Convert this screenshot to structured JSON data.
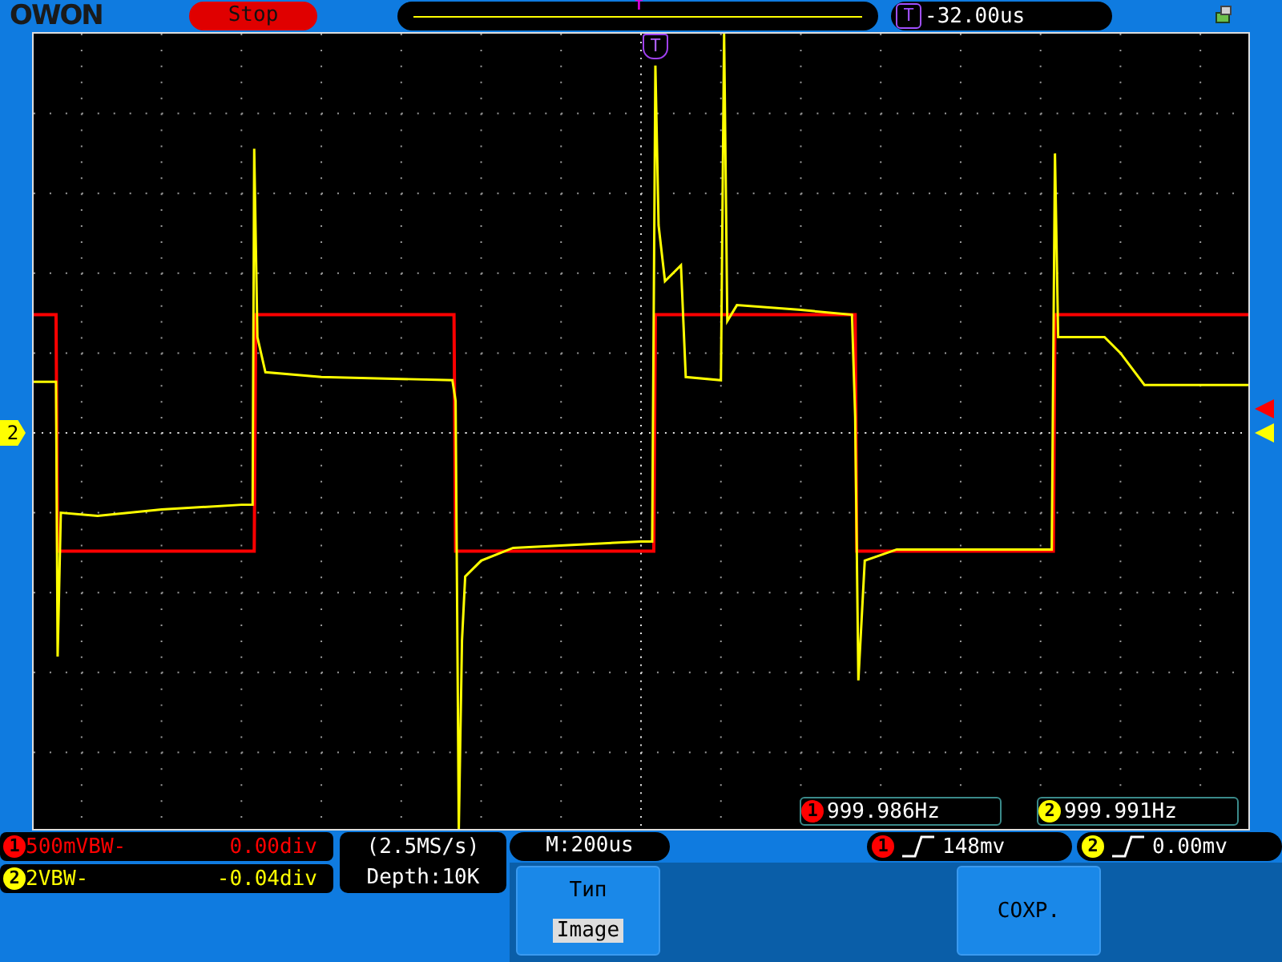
{
  "brand": {
    "logo": "OWON"
  },
  "run_state": {
    "label": "Stop"
  },
  "trigger_position": {
    "marker": "T"
  },
  "trigger_offset": {
    "badge": "T",
    "value": "-32.00us"
  },
  "screen": {
    "trigger_marker": "T",
    "ground_marker": "2",
    "frequencies": [
      {
        "channel": "1",
        "value": "999.986Hz"
      },
      {
        "channel": "2",
        "value": "999.991Hz"
      }
    ]
  },
  "channels": [
    {
      "number": "1",
      "color": "#ff0000",
      "scale": "500mV",
      "bandwidth": "BW-",
      "offset": "0.00div"
    },
    {
      "number": "2",
      "color": "#ffff00",
      "scale": "2V",
      "bandwidth": "BW-",
      "offset": "-0.04div"
    }
  ],
  "acquisition": {
    "sample_rate": "(2.5MS/s)",
    "depth": "Depth:10K"
  },
  "timebase": "M:200us",
  "triggers": [
    {
      "channel": "1",
      "value": "148mv"
    },
    {
      "channel": "2",
      "value": "0.00mv"
    }
  ],
  "menu": [
    {
      "kind": "option",
      "title": "Тип",
      "value": "Image"
    },
    {
      "kind": "action",
      "title": "СОХР."
    }
  ]
}
